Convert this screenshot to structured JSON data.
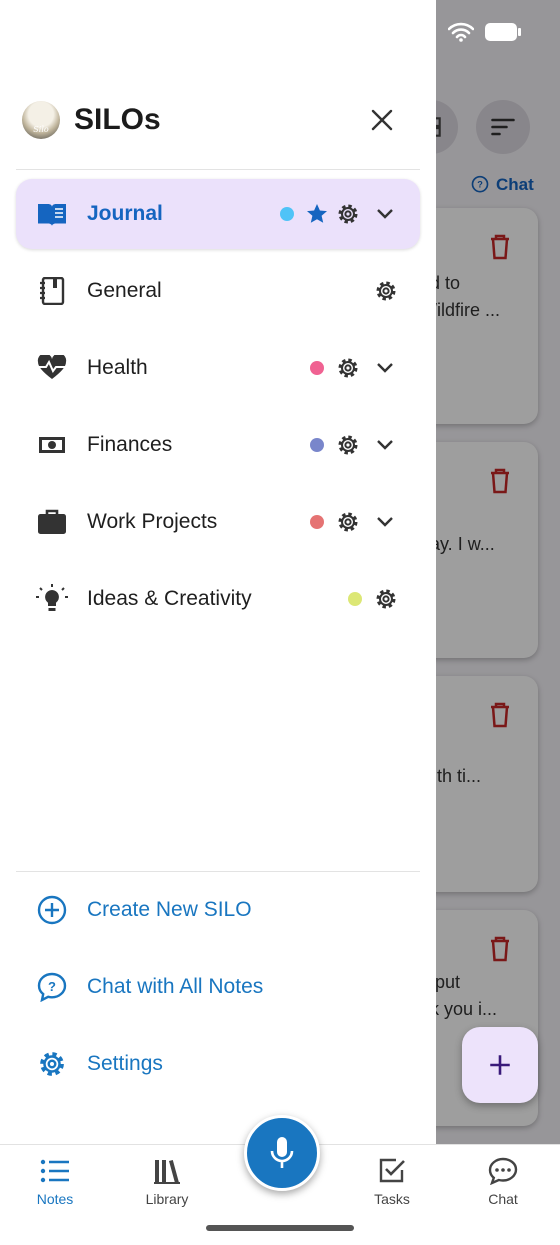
{
  "background": {
    "chat_link": "Chat",
    "cards": [
      {
        "lines": [
          "ed to",
          "Wildfire ..."
        ]
      },
      {
        "lines": [
          "day. I w..."
        ]
      },
      {
        "lines": [
          "with ti..."
        ]
      },
      {
        "lines": [
          "o put",
          "nk you i..."
        ]
      }
    ]
  },
  "drawer": {
    "title": "SILOs",
    "avatar_text": "Silo",
    "silos": [
      {
        "label": "Journal",
        "icon": "open-book-icon",
        "dot_color": "#4fc3f7",
        "favorite": true,
        "expandable": true,
        "active": true
      },
      {
        "label": "General",
        "icon": "notebook-icon",
        "dot_color": null,
        "favorite": false,
        "expandable": false,
        "active": false
      },
      {
        "label": "Health",
        "icon": "heart-pulse-icon",
        "dot_color": "#f06292",
        "favorite": false,
        "expandable": true,
        "active": false
      },
      {
        "label": "Finances",
        "icon": "banknote-icon",
        "dot_color": "#7986cb",
        "favorite": false,
        "expandable": true,
        "active": false
      },
      {
        "label": "Work Projects",
        "icon": "briefcase-icon",
        "dot_color": "#e57373",
        "favorite": false,
        "expandable": true,
        "active": false
      },
      {
        "label": "Ideas & Creativity",
        "icon": "lightbulb-icon",
        "dot_color": "#dce775",
        "favorite": false,
        "expandable": false,
        "active": false
      }
    ],
    "actions": [
      {
        "label": "Create New SILO",
        "icon": "plus-circle-icon"
      },
      {
        "label": "Chat with All Notes",
        "icon": "chat-question-icon"
      },
      {
        "label": "Settings",
        "icon": "gear-icon"
      }
    ]
  },
  "bottom_nav": {
    "items": [
      {
        "label": "Notes",
        "icon": "list-icon",
        "active": true
      },
      {
        "label": "Library",
        "icon": "library-icon",
        "active": false
      },
      {
        "label": "Tasks",
        "icon": "checkbox-icon",
        "active": false
      },
      {
        "label": "Chat",
        "icon": "chat-bubble-icon",
        "active": false
      }
    ]
  },
  "colors": {
    "accent": "#1976c0",
    "active_bg": "#ebe1fb",
    "trash": "#c62828"
  }
}
